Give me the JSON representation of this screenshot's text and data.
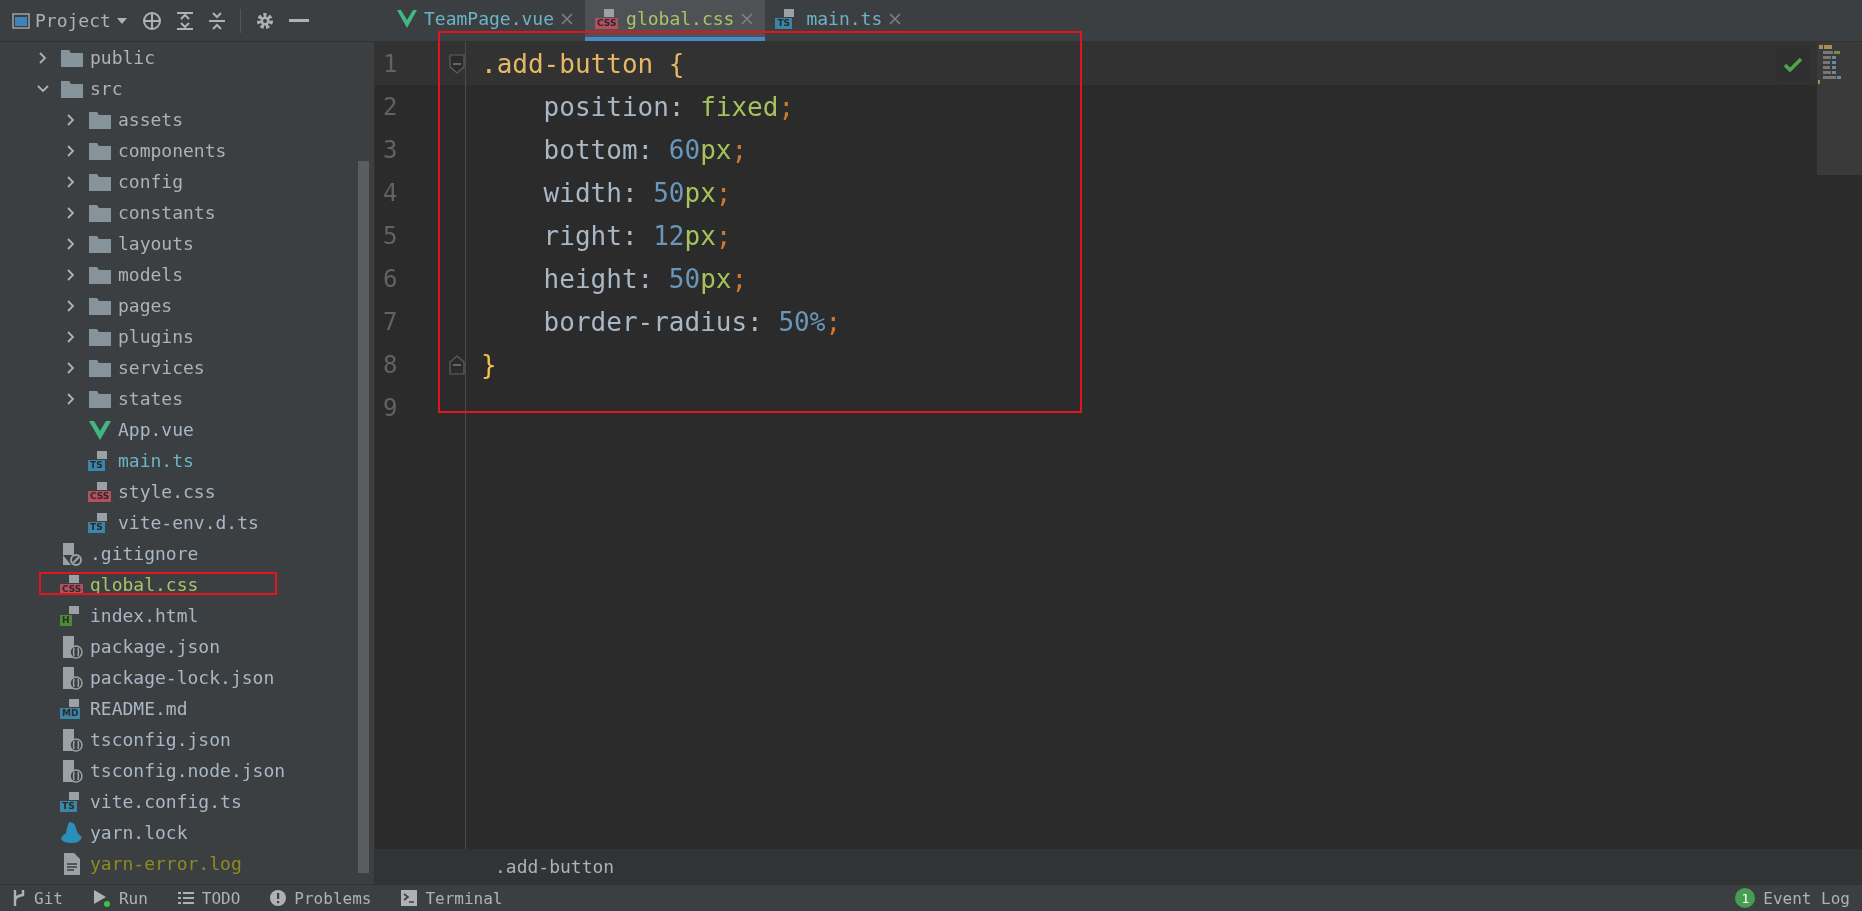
{
  "toolbar": {
    "title": "Project"
  },
  "tabs": [
    {
      "label": "TeamPage.vue",
      "kind": "vue",
      "color": "#6eb3c6",
      "selected": false
    },
    {
      "label": "global.css",
      "kind": "badge",
      "badge": "CSS",
      "color": "#a9c46a",
      "selected": true
    },
    {
      "label": "main.ts",
      "kind": "badge",
      "badge": "TS",
      "color": "#6eb3c6",
      "selected": false
    }
  ],
  "tree": [
    {
      "name": "public",
      "kind": "folder",
      "expanded": false
    },
    {
      "name": "src",
      "kind": "folder",
      "expanded": true,
      "children": [
        {
          "name": "assets",
          "kind": "folder",
          "expanded": false
        },
        {
          "name": "components",
          "kind": "folder",
          "expanded": false
        },
        {
          "name": "config",
          "kind": "folder",
          "expanded": false
        },
        {
          "name": "constants",
          "kind": "folder",
          "expanded": false
        },
        {
          "name": "layouts",
          "kind": "folder",
          "expanded": false
        },
        {
          "name": "models",
          "kind": "folder",
          "expanded": false
        },
        {
          "name": "pages",
          "kind": "folder",
          "expanded": false
        },
        {
          "name": "plugins",
          "kind": "folder",
          "expanded": false
        },
        {
          "name": "services",
          "kind": "folder",
          "expanded": false
        },
        {
          "name": "states",
          "kind": "folder",
          "expanded": false
        },
        {
          "name": "App.vue",
          "kind": "vue",
          "color": "#a9b7c6"
        },
        {
          "name": "main.ts",
          "kind": "badge",
          "badge": "TS",
          "color": "#6eb3c6"
        },
        {
          "name": "style.css",
          "kind": "badge",
          "badge": "CSS",
          "color": "#a9b7c6"
        },
        {
          "name": "vite-env.d.ts",
          "kind": "badge",
          "badge": "TS",
          "color": "#a9b7c6"
        }
      ]
    },
    {
      "name": ".gitignore",
      "kind": "ignore",
      "color": "#a9b7c6"
    },
    {
      "name": "global.css",
      "kind": "badge",
      "badge": "CSS",
      "color": "#a9c46a",
      "annotated": true
    },
    {
      "name": "index.html",
      "kind": "badge",
      "badge": "H",
      "color": "#a9b7c6"
    },
    {
      "name": "package.json",
      "kind": "json",
      "color": "#a9b7c6"
    },
    {
      "name": "package-lock.json",
      "kind": "json",
      "color": "#a9b7c6"
    },
    {
      "name": "README.md",
      "kind": "badge",
      "badge": "MD",
      "color": "#a9b7c6"
    },
    {
      "name": "tsconfig.json",
      "kind": "json",
      "color": "#a9b7c6"
    },
    {
      "name": "tsconfig.node.json",
      "kind": "json",
      "color": "#a9b7c6"
    },
    {
      "name": "vite.config.ts",
      "kind": "badge",
      "badge": "TS",
      "color": "#a9b7c6"
    },
    {
      "name": "yarn.lock",
      "kind": "yarn",
      "color": "#a9b7c6"
    },
    {
      "name": "yarn-error.log",
      "kind": "log",
      "color": "#8f8a20"
    }
  ],
  "editor": {
    "annotated": true,
    "lines": [
      {
        "number": "1",
        "current": true,
        "fold_start": true,
        "tokens": [
          {
            "text": ".add-button {",
            "kind": "selector"
          }
        ]
      },
      {
        "number": "2",
        "indented": true,
        "tokens": [
          {
            "text": "position: ",
            "kind": "property"
          },
          {
            "text": "fixed",
            "kind": "value"
          },
          {
            "text": ";",
            "kind": "punct"
          }
        ]
      },
      {
        "number": "3",
        "indented": true,
        "tokens": [
          {
            "text": "bottom: ",
            "kind": "property"
          },
          {
            "text": "60",
            "kind": "number"
          },
          {
            "text": "px",
            "kind": "value"
          },
          {
            "text": ";",
            "kind": "punct"
          }
        ]
      },
      {
        "number": "4",
        "indented": true,
        "tokens": [
          {
            "text": "width: ",
            "kind": "property"
          },
          {
            "text": "50",
            "kind": "number"
          },
          {
            "text": "px",
            "kind": "value"
          },
          {
            "text": ";",
            "kind": "punct"
          }
        ]
      },
      {
        "number": "5",
        "indented": true,
        "tokens": [
          {
            "text": "right: ",
            "kind": "property"
          },
          {
            "text": "12",
            "kind": "number"
          },
          {
            "text": "px",
            "kind": "value"
          },
          {
            "text": ";",
            "kind": "punct"
          }
        ]
      },
      {
        "number": "6",
        "indented": true,
        "tokens": [
          {
            "text": "height: ",
            "kind": "property"
          },
          {
            "text": "50",
            "kind": "number"
          },
          {
            "text": "px",
            "kind": "value"
          },
          {
            "text": ";",
            "kind": "punct"
          }
        ]
      },
      {
        "number": "7",
        "indented": true,
        "tokens": [
          {
            "text": "border-radius: ",
            "kind": "property"
          },
          {
            "text": "50%",
            "kind": "number"
          },
          {
            "text": ";",
            "kind": "punct"
          }
        ]
      },
      {
        "number": "8",
        "fold_end": true,
        "tokens": [
          {
            "text": "}",
            "kind": "brace"
          }
        ]
      },
      {
        "number": "9"
      }
    ]
  },
  "breadcrumb": ".add-button",
  "status_bar": [
    {
      "label": "Git",
      "kind": "git"
    },
    {
      "label": "Run",
      "kind": "run"
    },
    {
      "label": "TODO",
      "kind": "todo"
    },
    {
      "label": "Problems",
      "kind": "problems"
    },
    {
      "label": "Terminal",
      "kind": "terminal"
    }
  ],
  "event_log": {
    "label": "Event Log",
    "badge": "1"
  }
}
